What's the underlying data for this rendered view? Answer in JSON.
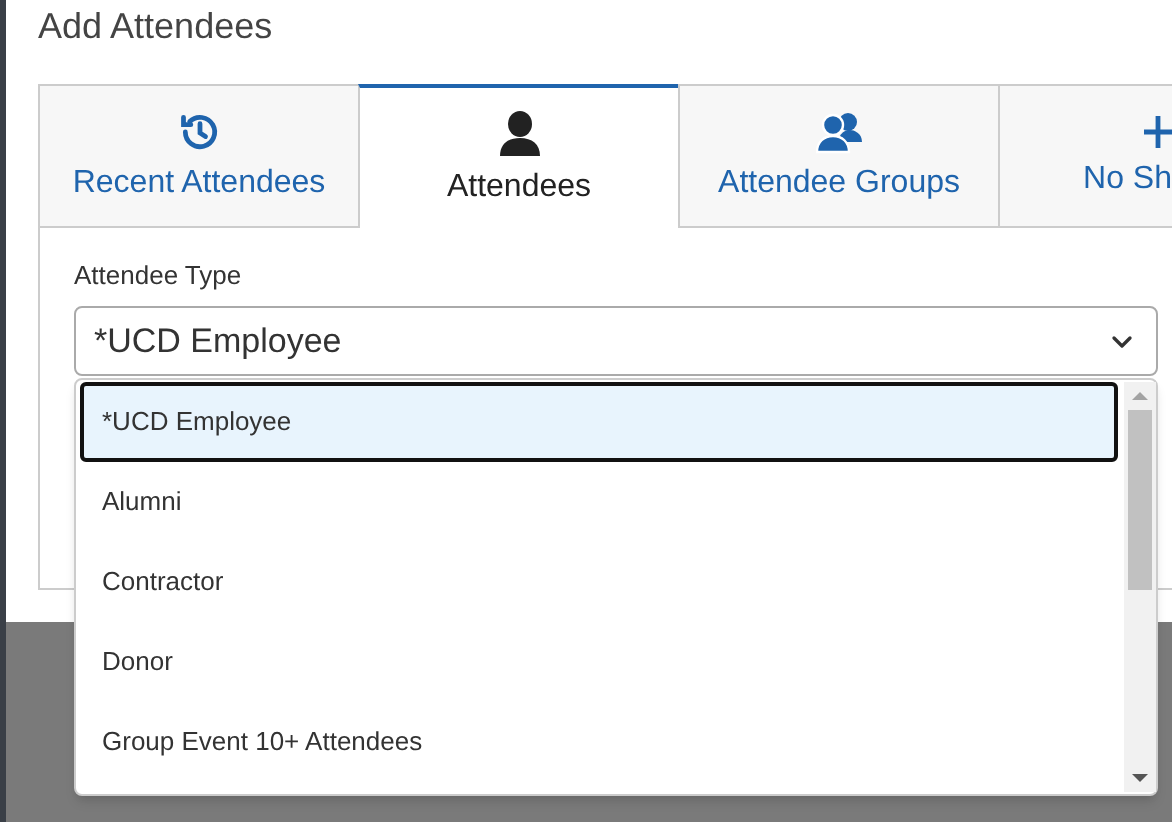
{
  "dialog": {
    "title": "Add Attendees"
  },
  "tabs": [
    {
      "label": "Recent Attendees",
      "kind": "history",
      "selected": false
    },
    {
      "label": "Attendees",
      "kind": "person",
      "selected": true
    },
    {
      "label": "Attendee Groups",
      "kind": "group",
      "selected": false
    },
    {
      "label": "No Sh",
      "kind": "plus",
      "selected": false
    }
  ],
  "attendee_type": {
    "label": "Attendee Type",
    "value": "*UCD Employee"
  },
  "options": [
    {
      "label": "*UCD Employee",
      "selected": true
    },
    {
      "label": "Alumni",
      "selected": false
    },
    {
      "label": "Contractor",
      "selected": false
    },
    {
      "label": "Donor",
      "selected": false
    },
    {
      "label": "Group Event 10+ Attendees",
      "selected": false
    }
  ]
}
